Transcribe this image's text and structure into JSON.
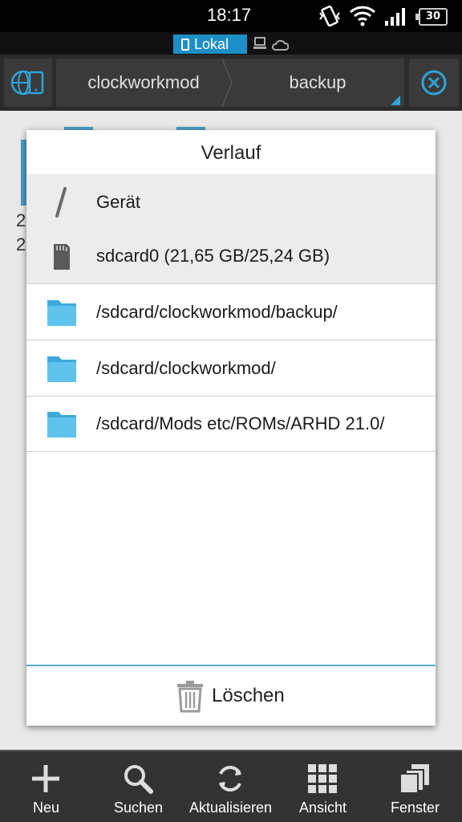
{
  "status_bar": {
    "time": "18:17",
    "battery": "30",
    "icons": [
      "vibrate-icon",
      "wifi-icon",
      "signal-icon",
      "battery-icon"
    ]
  },
  "location_tabs": {
    "active": "Lokal",
    "others": [
      "network-icon",
      "cloud-icon"
    ]
  },
  "path_bar": {
    "crumbs": [
      "clockworkmod",
      "backup"
    ],
    "left_icon": "globe-device-icon",
    "right_icon": "close-circle-icon"
  },
  "background_files": {
    "peek_text_1": "2",
    "peek_text_2": "2"
  },
  "history_dialog": {
    "title": "Verlauf",
    "items": [
      {
        "label": "Gerät",
        "icon": "root-slash-icon"
      },
      {
        "label": "sdcard0 (21,65 GB/25,24 GB)",
        "icon": "sdcard-icon"
      },
      {
        "label": "/sdcard/clockworkmod/backup/",
        "icon": "folder-icon"
      },
      {
        "label": "/sdcard/clockworkmod/",
        "icon": "folder-icon"
      },
      {
        "label": "/sdcard/Mods etc/ROMs/ARHD 21.0/",
        "icon": "folder-icon"
      }
    ],
    "clear_label": "Löschen"
  },
  "bottom_nav": [
    {
      "label": "Neu",
      "icon": "plus-icon"
    },
    {
      "label": "Suchen",
      "icon": "search-icon"
    },
    {
      "label": "Aktualisieren",
      "icon": "refresh-icon"
    },
    {
      "label": "Ansicht",
      "icon": "grid-view-icon"
    },
    {
      "label": "Fenster",
      "icon": "windows-icon"
    }
  ],
  "colors": {
    "accent": "#1e8fc6",
    "folder": "#5fc3ee",
    "divider": "#5aa9d6"
  }
}
